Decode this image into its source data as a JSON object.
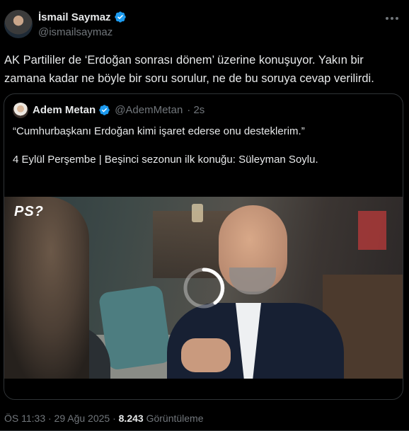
{
  "author": {
    "display_name": "İsmail Saymaz",
    "handle": "@ismailsaymaz"
  },
  "tweet": {
    "text": "AK Partililer de ‘Erdoğan sonrası dönem’ üzerine konuşuyor. Yakın bir zamana kadar ne böyle bir soru sorulur, ne de bu soruya cevap verilirdi."
  },
  "quoted": {
    "display_name": "Adem Metan",
    "handle": "@AdemMetan",
    "time": "· 2s",
    "line1": "“Cumhurbaşkanı Erdoğan kimi işaret ederse onu desteklerim.”",
    "line2": "4 Eylül Perşembe | Beşinci sezonun ilk konuğu: Süleyman Soylu.",
    "video_logo": "PS?"
  },
  "meta": {
    "timestamp": "ÖS 11:33 · 29 Ağu 2025 ·",
    "views_count": "8.243",
    "views_label": "Görüntüleme"
  },
  "colors": {
    "verified": "#1d9bf0",
    "muted": "#71767b",
    "text": "#e7e9ea",
    "border": "#2f3336"
  }
}
